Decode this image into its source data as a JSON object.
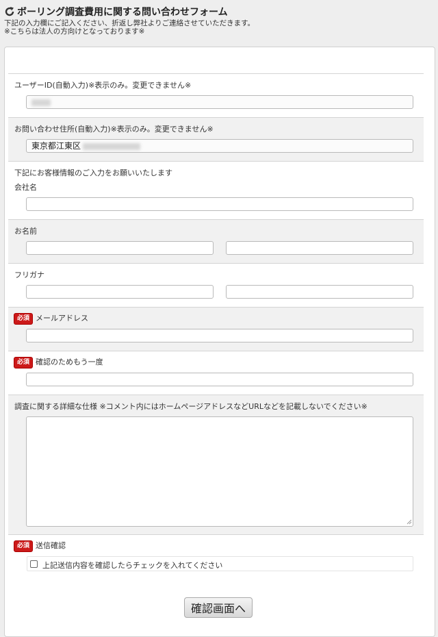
{
  "header": {
    "title": "ボーリング調査費用に関する問い合わせフォーム",
    "desc_line1": "下記の入力欄にご記入ください、折返し弊社よりご連絡させていただきます。",
    "desc_line2": "※こちらは法人の方向けとなっております※"
  },
  "form": {
    "required_badge": "必須",
    "user_id": {
      "label": "ユーザーID(自動入力)※表示のみ。変更できません※",
      "value": ""
    },
    "address": {
      "label": "お問い合わせ住所(自動入力)※表示のみ。変更できません※",
      "value": "東京都江東区"
    },
    "intro": "下記にお客様情報のご入力をお願いいたします",
    "company": {
      "label": "会社名",
      "value": ""
    },
    "name": {
      "label": "お名前",
      "last": "",
      "first": ""
    },
    "furigana": {
      "label": "フリガナ",
      "last": "",
      "first": ""
    },
    "email": {
      "label": "メールアドレス",
      "value": ""
    },
    "email_confirm": {
      "label": "確認のためもう一度",
      "value": ""
    },
    "details": {
      "label": "調査に関する詳細な仕様 ※コメント内にはホームページアドレスなどURLなどを記載しないでください※",
      "value": ""
    },
    "send_confirm": {
      "label": "送信確認",
      "checkbox_label": "上記送信内容を確認したらチェックを入れてください",
      "checked": false
    },
    "submit_label": "確認画面へ"
  }
}
